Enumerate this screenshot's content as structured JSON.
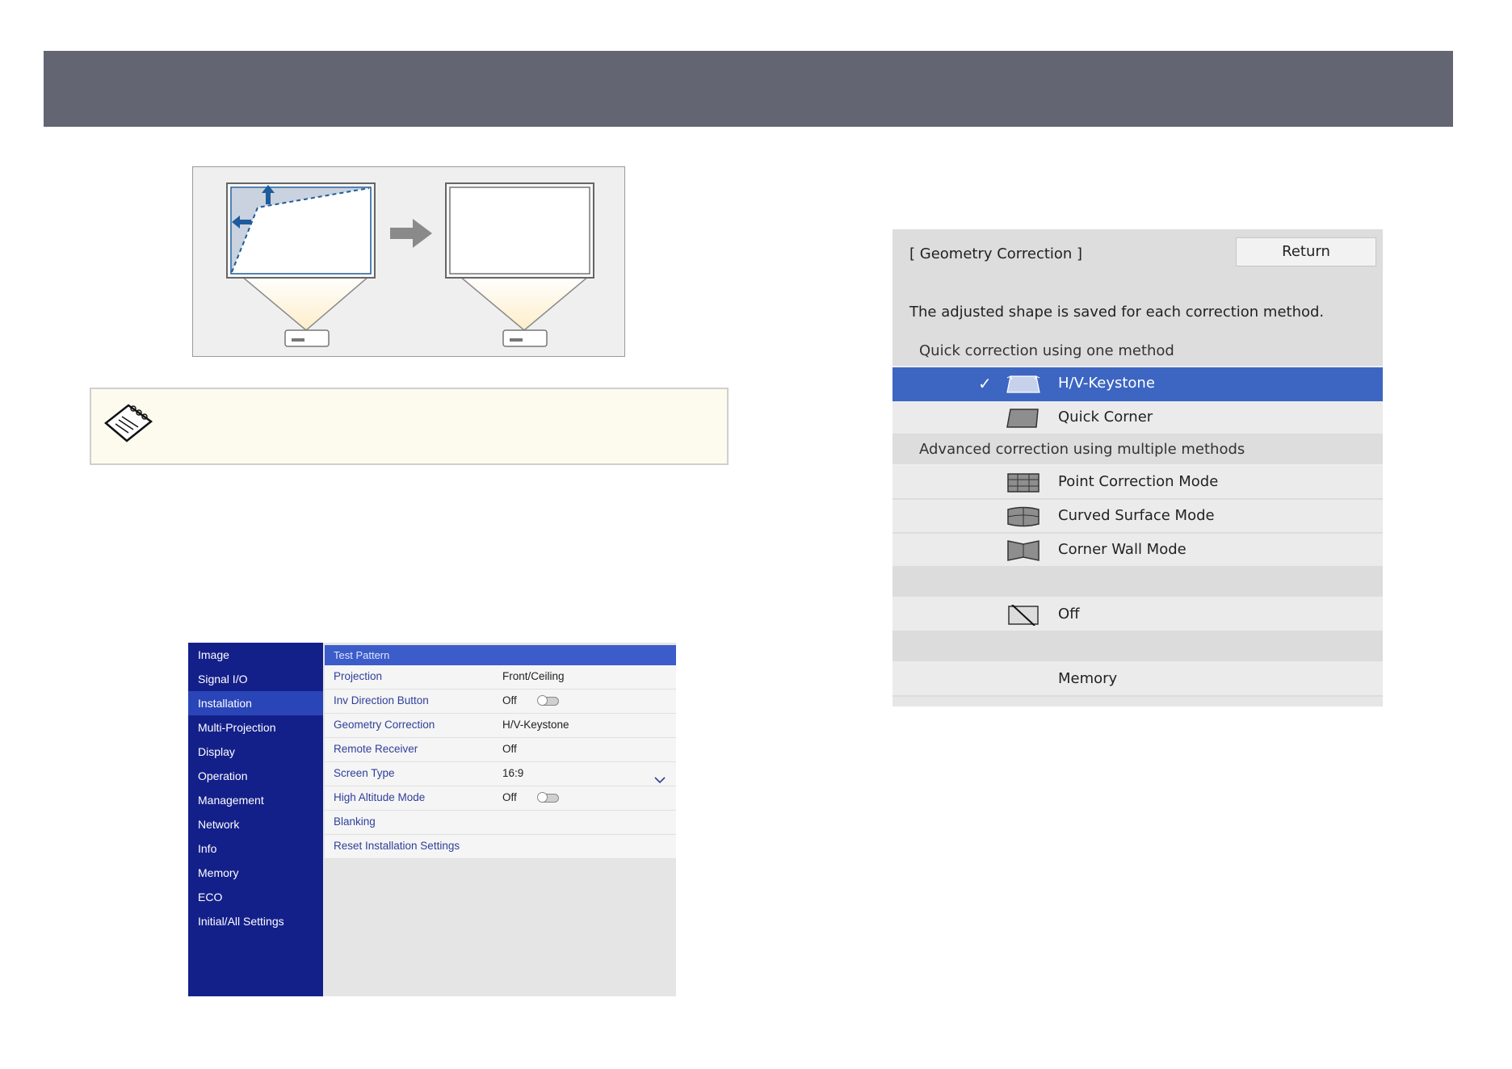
{
  "menu": {
    "sidebar": [
      "Image",
      "Signal I/O",
      "Installation",
      "Multi-Projection",
      "Display",
      "Operation",
      "Management",
      "Network",
      "Info",
      "Memory",
      "ECO",
      "Initial/All Settings"
    ],
    "active_section": "Installation",
    "header": "Test Pattern",
    "rows": [
      {
        "label": "Projection",
        "value": "Front/Ceiling"
      },
      {
        "label": "Inv Direction Button",
        "value": "Off",
        "control": "toggle"
      },
      {
        "label": "Geometry Correction",
        "value": "H/V-Keystone"
      },
      {
        "label": "Remote Receiver",
        "value": "Off"
      },
      {
        "label": "Screen Type",
        "value": "16:9",
        "control": "dropdown"
      },
      {
        "label": "High Altitude Mode",
        "value": "Off",
        "control": "toggle"
      },
      {
        "label": "Blanking",
        "value": ""
      },
      {
        "label": "Reset Installation Settings",
        "value": ""
      }
    ]
  },
  "geometry": {
    "title": "[ Geometry Correction ]",
    "return_label": "Return",
    "description": "The adjusted shape is saved for each correction method.",
    "quick_section": "Quick correction using one method",
    "hv_keystone": "H/V-Keystone",
    "quick_corner": "Quick Corner",
    "advanced_section": "Advanced correction using multiple methods",
    "point_correction": "Point Correction Mode",
    "curved_surface": "Curved Surface Mode",
    "corner_wall": "Corner Wall Mode",
    "off": "Off",
    "memory": "Memory",
    "selected": "H/V-Keystone",
    "check_mark": "✓"
  },
  "colors": {
    "header_band": "#636573",
    "menu_sidebar": "#14208a",
    "menu_active": "#2a45b8",
    "geo_selected": "#3d66c2",
    "note_background": "#fdfbee"
  },
  "icons": {
    "note": "note-pad-icon",
    "arrow": "right-arrow-icon"
  }
}
